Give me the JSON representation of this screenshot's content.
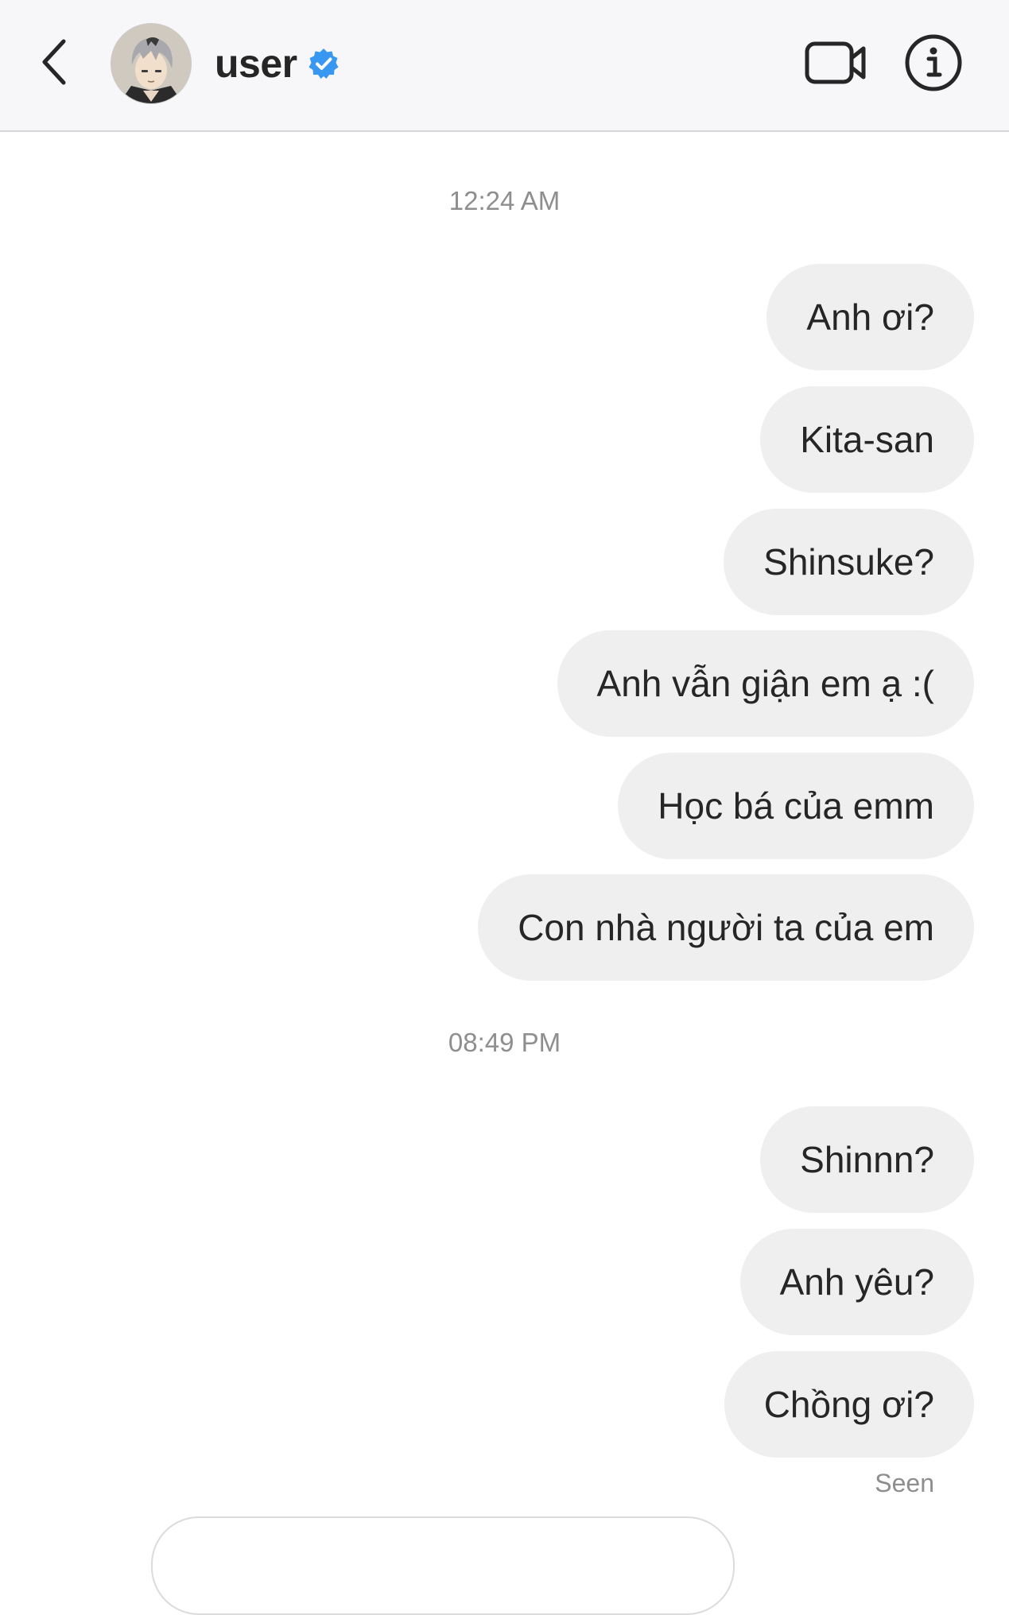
{
  "header": {
    "username": "user",
    "verified": true,
    "back_icon": "chevron-left-icon",
    "video_icon": "video-camera-icon",
    "info_icon": "info-icon"
  },
  "colors": {
    "header_bg": "#f7f7f9",
    "bubble_bg": "#efefef",
    "verified_blue": "#3897f0",
    "text": "#262626",
    "muted": "#8e8e8e"
  },
  "conversation": {
    "groups": [
      {
        "timestamp": "12:24 AM",
        "messages": [
          "Anh ơi?",
          "Kita-san",
          "Shinsuke?",
          "Anh vẫn giận em ạ :(",
          "Học bá của emm",
          "Con nhà người ta của em"
        ]
      },
      {
        "timestamp": "08:49 PM",
        "messages": [
          "Shinnn?",
          "Anh yêu?",
          "Chồng ơi?"
        ]
      }
    ],
    "status": "Seen"
  }
}
